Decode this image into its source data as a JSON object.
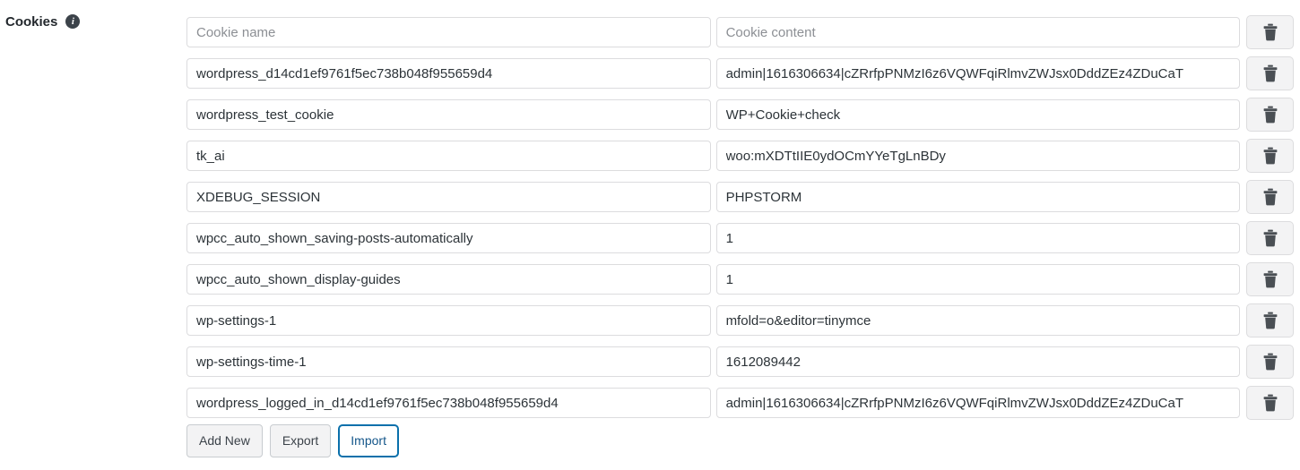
{
  "section": {
    "label": "Cookies",
    "info_icon": "info-icon",
    "info_icon_glyph": "i"
  },
  "table": {
    "columns": [
      "Cookie name",
      "Cookie content"
    ],
    "placeholders": {
      "name": "Cookie name",
      "content": "Cookie content"
    },
    "delete_icon": "trash-icon",
    "header_row": {
      "name": "",
      "content": ""
    },
    "rows": [
      {
        "name": "wordpress_d14cd1ef9761f5ec738b048f955659d4",
        "content": "admin|1616306634|cZRrfpPNMzI6z6VQWFqiRlmvZWJsx0DddZEz4ZDuCaT"
      },
      {
        "name": "wordpress_test_cookie",
        "content": "WP+Cookie+check"
      },
      {
        "name": "tk_ai",
        "content": "woo:mXDTtIIE0ydOCmYYeTgLnBDy"
      },
      {
        "name": "XDEBUG_SESSION",
        "content": "PHPSTORM"
      },
      {
        "name": "wpcc_auto_shown_saving-posts-automatically",
        "content": "1"
      },
      {
        "name": "wpcc_auto_shown_display-guides",
        "content": "1"
      },
      {
        "name": "wp-settings-1",
        "content": "mfold=o&editor=tinymce"
      },
      {
        "name": "wp-settings-time-1",
        "content": "1612089442"
      },
      {
        "name": "wordpress_logged_in_d14cd1ef9761f5ec738b048f955659d4",
        "content": "admin|1616306634|cZRrfpPNMzI6z6VQWFqiRlmvZWJsx0DddZEz4ZDuCaT"
      }
    ]
  },
  "actions": {
    "add_new_label": "Add New",
    "export_label": "Export",
    "import_label": "Import"
  },
  "colors": {
    "focus_blue": "#0a70ab",
    "import_text": "#14568a",
    "button_bg": "#f3f3f4",
    "input_border": "#dcdcde",
    "text": "#2c3338",
    "placeholder": "#8c8f94"
  }
}
